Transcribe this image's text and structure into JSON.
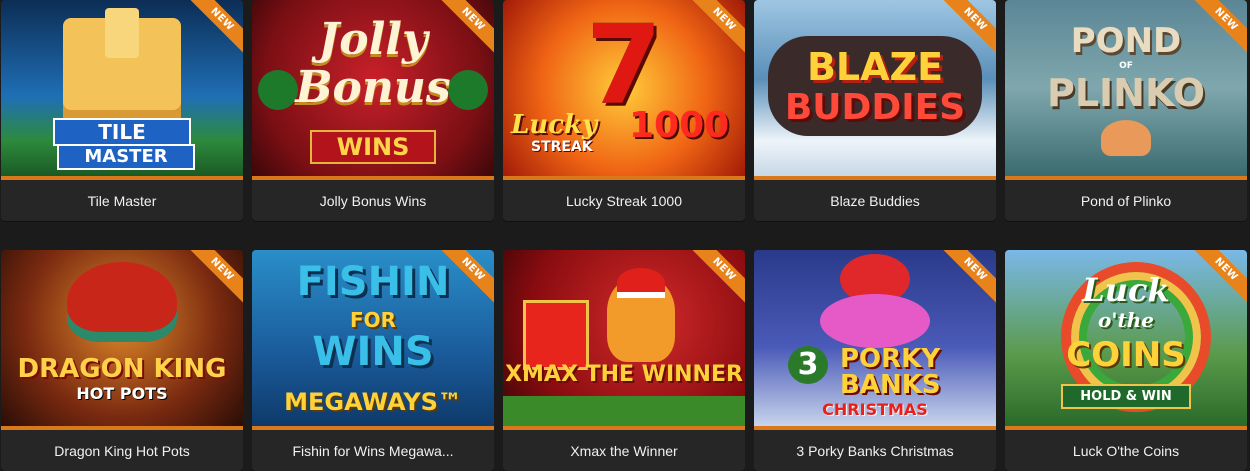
{
  "new_badge": "NEW",
  "games": [
    {
      "name": "Tile Master",
      "art": {
        "line1": "TILE",
        "line2": "MASTER"
      }
    },
    {
      "name": "Jolly Bonus Wins",
      "art": {
        "line1": "Jolly",
        "line2": "Bonus",
        "line3": "WINS"
      }
    },
    {
      "name": "Lucky Streak 1000",
      "art": {
        "line1": "7",
        "line2": "Lucky",
        "line3": "STREAK",
        "line4": "1000"
      }
    },
    {
      "name": "Blaze Buddies",
      "art": {
        "line1": "BLAZE",
        "line2": "BUDDIES"
      }
    },
    {
      "name": "Pond of Plinko",
      "art": {
        "line1": "POND",
        "line2": "OF",
        "line3": "PLINKO"
      }
    },
    {
      "name": "Dragon King Hot Pots",
      "art": {
        "line1": "DRAGON KING",
        "line2": "HOT POTS"
      }
    },
    {
      "name": "Fishin for Wins Megawa...",
      "art": {
        "line1": "FISHIN",
        "line2": "FOR",
        "line3": "WINS",
        "line4": "MEGAWAYS™"
      }
    },
    {
      "name": "Xmax the Winner",
      "art": {
        "line1": "XMAX THE WINNER"
      }
    },
    {
      "name": "3 Porky Banks Christmas",
      "art": {
        "line1": "3",
        "line2": "PORKY",
        "line3": "BANKS",
        "line4": "CHRISTMAS"
      }
    },
    {
      "name": "Luck O'the Coins",
      "art": {
        "line1": "Luck",
        "line2": "o'the",
        "line3": "COINS",
        "line4": "HOLD & WIN"
      }
    }
  ],
  "colors": {
    "accent": "#d9791c",
    "card": "#262626",
    "page": "#1b1b1b",
    "badge": "#e8831c"
  }
}
